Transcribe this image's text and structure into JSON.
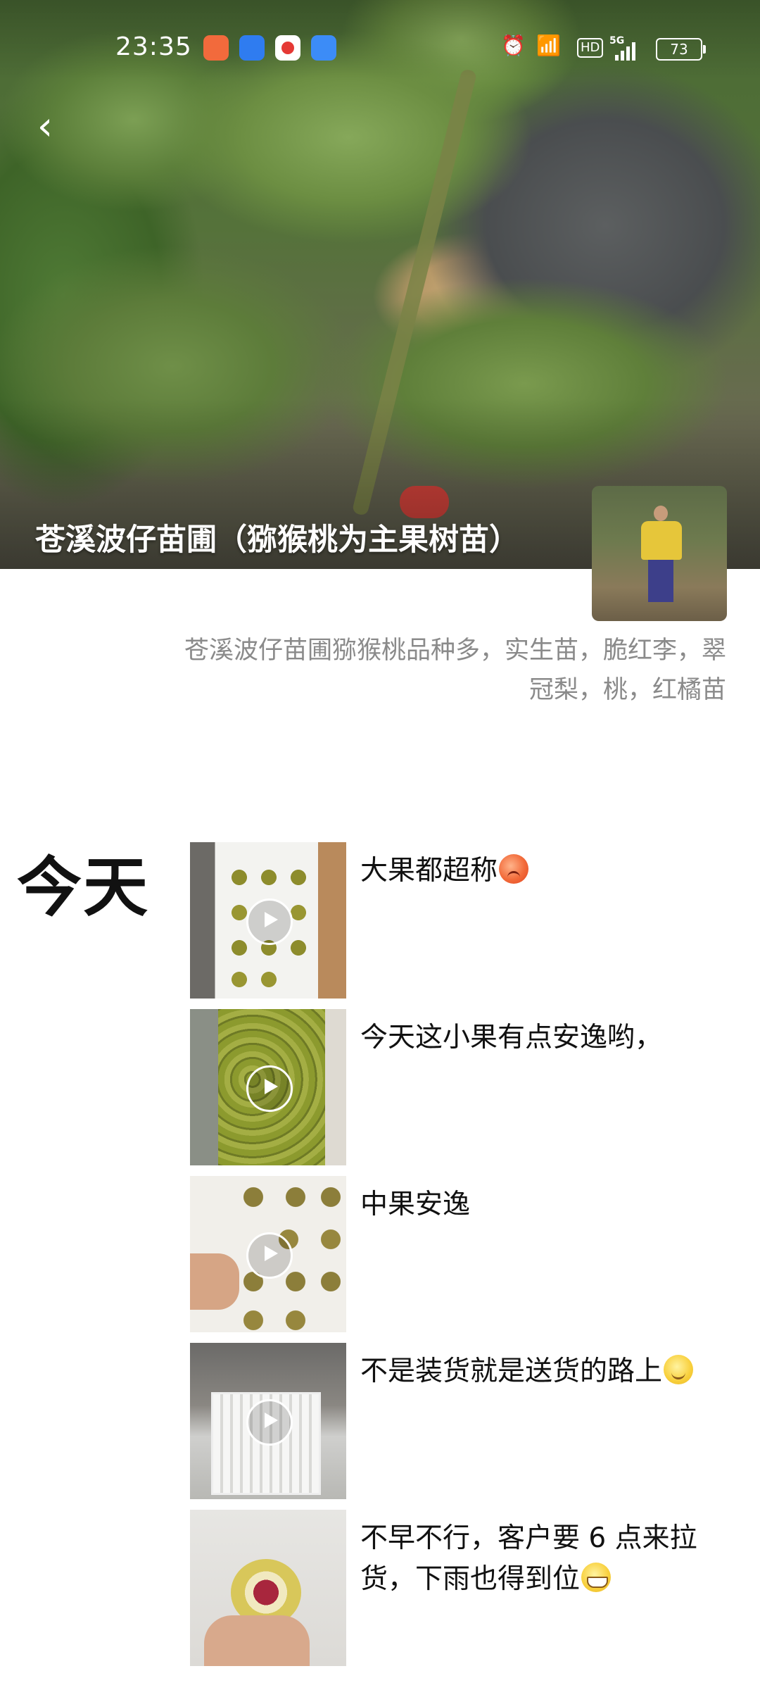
{
  "status_bar": {
    "time": "23:35",
    "hd_label": "HD",
    "signal_label": "5G",
    "battery_level": "73"
  },
  "nav": {
    "back_icon": "chevron-left-icon",
    "back_glyph": "‹"
  },
  "profile": {
    "cover_title": "苍溪波仔苗圃（猕猴桃为主果树苗）",
    "bio": "苍溪波仔苗圃猕猴桃品种多，实生苗，脆红李，翠冠梨，桃，红橘苗"
  },
  "feed": {
    "day_label": "今天",
    "posts": [
      {
        "text": "大果都超称",
        "media": "video",
        "emoji": "sweating-face"
      },
      {
        "text": "今天这小果有点安逸哟，",
        "media": "video",
        "emoji": ""
      },
      {
        "text": "中果安逸",
        "media": "video",
        "emoji": ""
      },
      {
        "text": "不是装货就是送货的路上",
        "media": "video",
        "emoji": "smiling-face"
      },
      {
        "text": "不早不行，客户要 6 点来拉货，下雨也得到位",
        "media": "image",
        "emoji": "grinning-face"
      }
    ]
  },
  "colors": {
    "bio_text": "#8a8a8a",
    "title_text": "#ffffff",
    "body_text": "#111111",
    "background": "#ffffff"
  }
}
